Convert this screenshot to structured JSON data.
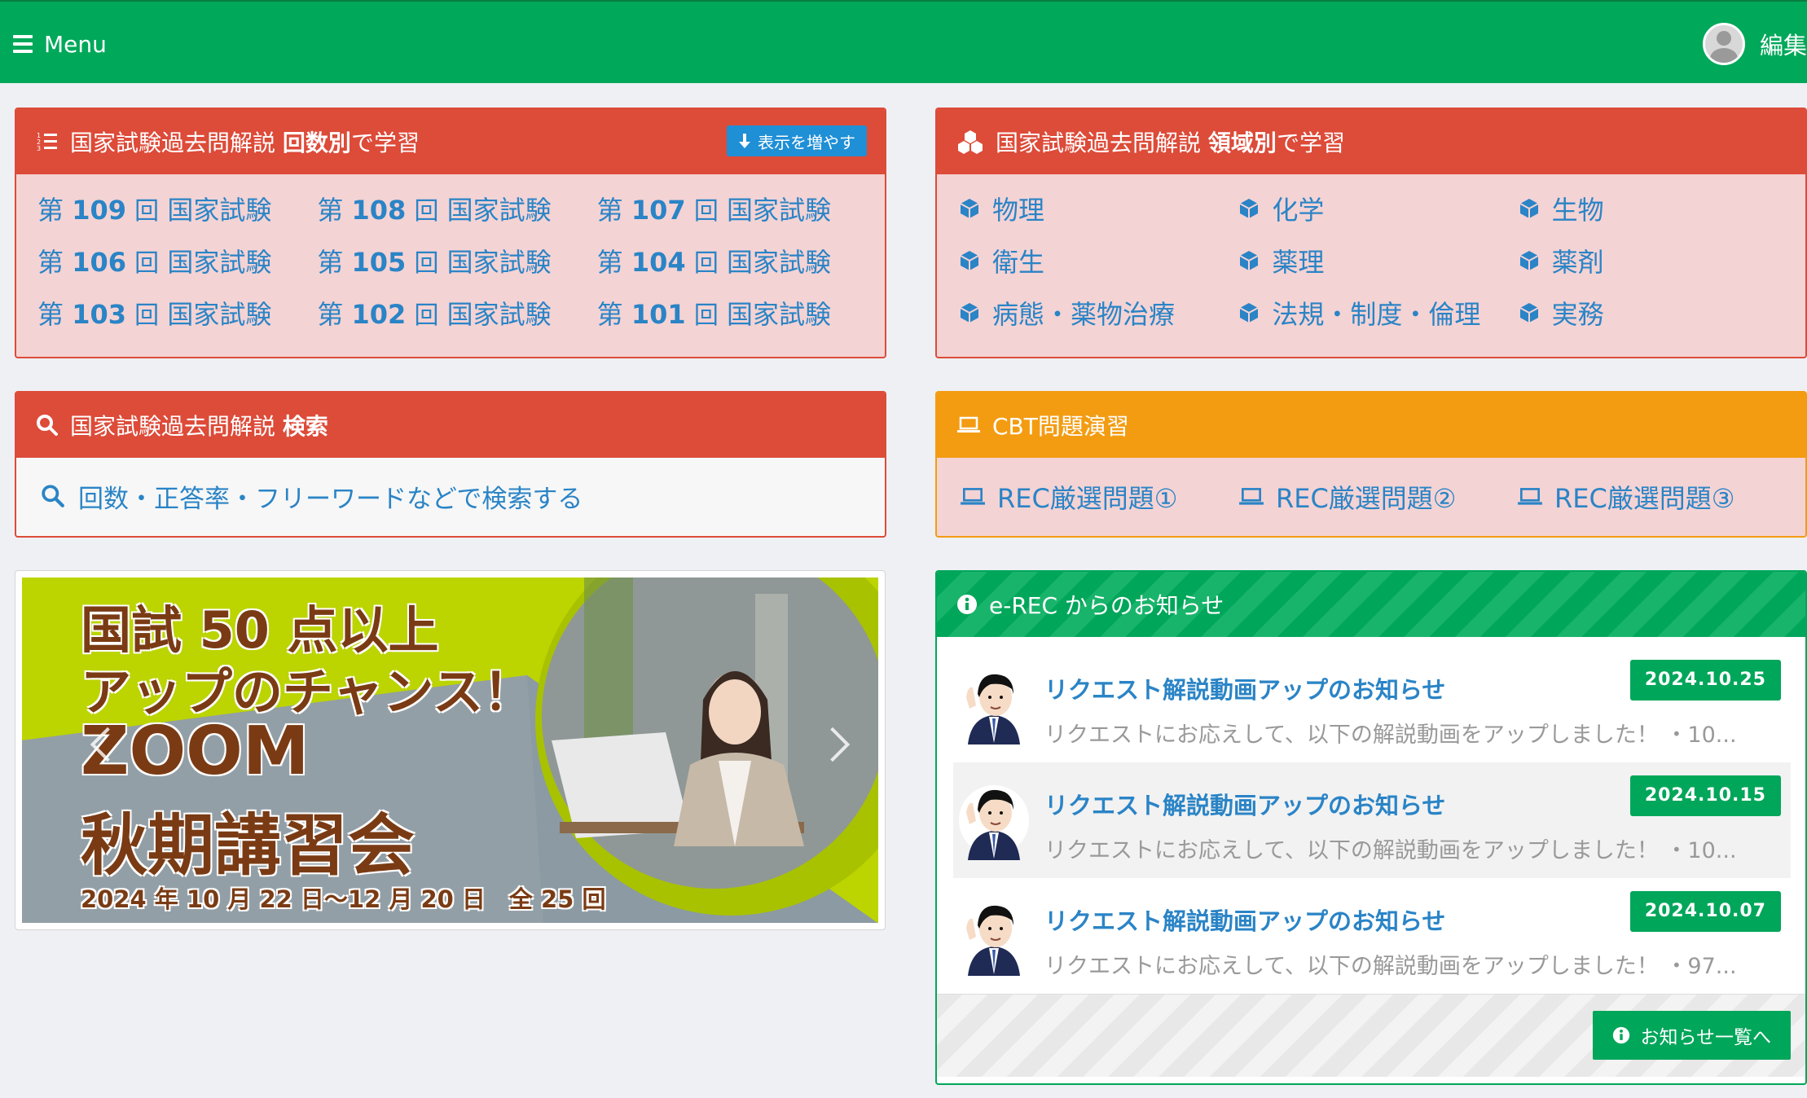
{
  "header": {
    "menu_label": "Menu",
    "edit_label": "編集"
  },
  "kaisu": {
    "title_prefix": "国家試験過去問解説",
    "title_bold": "回数別",
    "title_suffix": "で学習",
    "more_label": "表示を増やす",
    "items": [
      {
        "pre": "第",
        "num": "109",
        "kai": "回",
        "exam": "国家試験"
      },
      {
        "pre": "第",
        "num": "108",
        "kai": "回",
        "exam": "国家試験"
      },
      {
        "pre": "第",
        "num": "107",
        "kai": "回",
        "exam": "国家試験"
      },
      {
        "pre": "第",
        "num": "106",
        "kai": "回",
        "exam": "国家試験"
      },
      {
        "pre": "第",
        "num": "105",
        "kai": "回",
        "exam": "国家試験"
      },
      {
        "pre": "第",
        "num": "104",
        "kai": "回",
        "exam": "国家試験"
      },
      {
        "pre": "第",
        "num": "103",
        "kai": "回",
        "exam": "国家試験"
      },
      {
        "pre": "第",
        "num": "102",
        "kai": "回",
        "exam": "国家試験"
      },
      {
        "pre": "第",
        "num": "101",
        "kai": "回",
        "exam": "国家試験"
      }
    ]
  },
  "ryoiki": {
    "title_prefix": "国家試験過去問解説",
    "title_bold": "領域別",
    "title_suffix": "で学習",
    "items": [
      "物理",
      "化学",
      "生物",
      "衛生",
      "薬理",
      "薬剤",
      "病態・薬物治療",
      "法規・制度・倫理",
      "実務"
    ]
  },
  "search": {
    "title_prefix": "国家試験過去問解説",
    "title_bold": "検索",
    "link_label": "回数・正答率・フリーワードなどで検索する"
  },
  "cbt": {
    "title": "CBT問題演習",
    "items": [
      "REC厳選問題①",
      "REC厳選問題②",
      "REC厳選問題③"
    ]
  },
  "banner": {
    "line1": "国試 50 点以上",
    "line2": "アップのチャンス！",
    "line3": "ZOOM",
    "line4": "秋期講習会",
    "line5": "2024 年 10 月 22 日〜12 月 20 日　全 25 回"
  },
  "news": {
    "title": "e-REC からのお知らせ",
    "all_label": "お知らせ一覧へ",
    "items": [
      {
        "title": "リクエスト解説動画アップのお知らせ",
        "date": "2024.10.25",
        "desc": "リクエストにお応えして、以下の解説動画をアップしました！ ・10..."
      },
      {
        "title": "リクエスト解説動画アップのお知らせ",
        "date": "2024.10.15",
        "desc": "リクエストにお応えして、以下の解説動画をアップしました！ ・10..."
      },
      {
        "title": "リクエスト解説動画アップのお知らせ",
        "date": "2024.10.07",
        "desc": "リクエストにお応えして、以下の解説動画をアップしました！ ・97..."
      }
    ]
  }
}
